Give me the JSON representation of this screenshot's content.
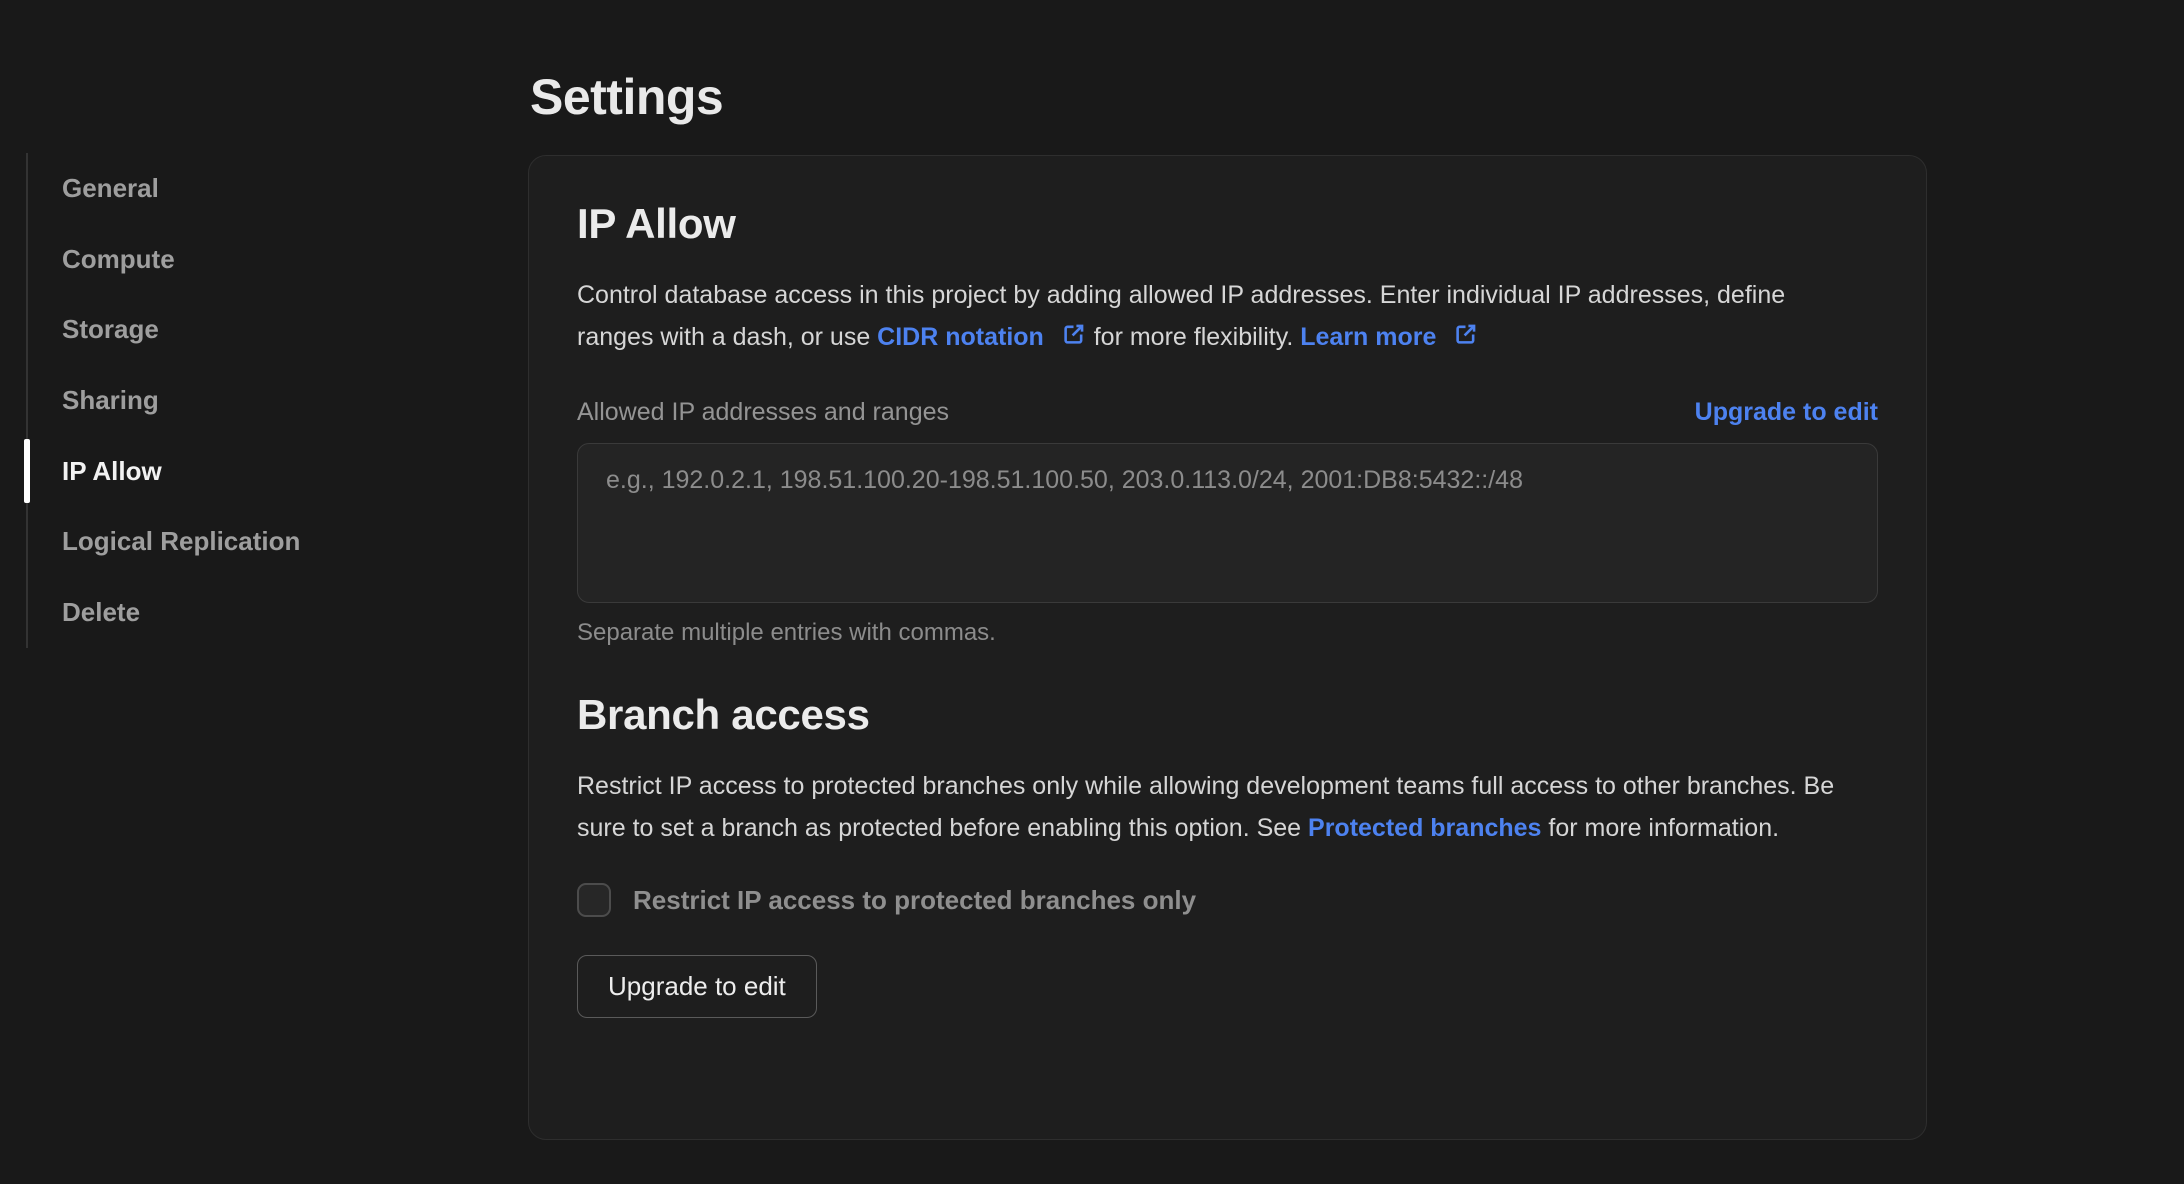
{
  "page": {
    "title": "Settings"
  },
  "colors": {
    "accent_blue": "#4d82f0",
    "active_indicator": "#ffffff"
  },
  "sidebar": {
    "items": [
      {
        "label": "General",
        "active": false
      },
      {
        "label": "Compute",
        "active": false
      },
      {
        "label": "Storage",
        "active": false
      },
      {
        "label": "Sharing",
        "active": false
      },
      {
        "label": "IP Allow",
        "active": true
      },
      {
        "label": "Logical Replication",
        "active": false
      },
      {
        "label": "Delete",
        "active": false
      }
    ]
  },
  "card": {
    "ip_allow": {
      "heading": "IP Allow",
      "description_segments": [
        {
          "text": "Control database access in this project by adding allowed IP addresses. Enter individual IP addresses, define ranges with a dash, or use "
        },
        {
          "text": "CIDR notation",
          "link": true,
          "external": true,
          "name": "cidr-notation-link"
        },
        {
          "text": " for more flexibility. "
        },
        {
          "text": "Learn more",
          "link": true,
          "external": true,
          "name": "learn-more-link"
        }
      ],
      "field_label": "Allowed IP addresses and ranges",
      "upgrade_link": "Upgrade to edit",
      "textarea_placeholder": "e.g., 192.0.2.1, 198.51.100.20-198.51.100.50, 203.0.113.0/24, 2001:DB8:5432::/48",
      "textarea_value": "",
      "helper": "Separate multiple entries with commas."
    },
    "branch_access": {
      "heading": "Branch access",
      "description_segments": [
        {
          "text": "Restrict IP access to protected branches only while allowing development teams full access to other branches. Be sure to set a branch as protected before enabling this option. See "
        },
        {
          "text": "Protected branches",
          "link": true,
          "name": "protected-branches-link"
        },
        {
          "text": " for more information."
        }
      ],
      "checkbox_label": "Restrict IP access to protected branches only",
      "checkbox_checked": false,
      "upgrade_button": "Upgrade to edit"
    }
  },
  "icons": {
    "external_link": "external-link-icon"
  }
}
